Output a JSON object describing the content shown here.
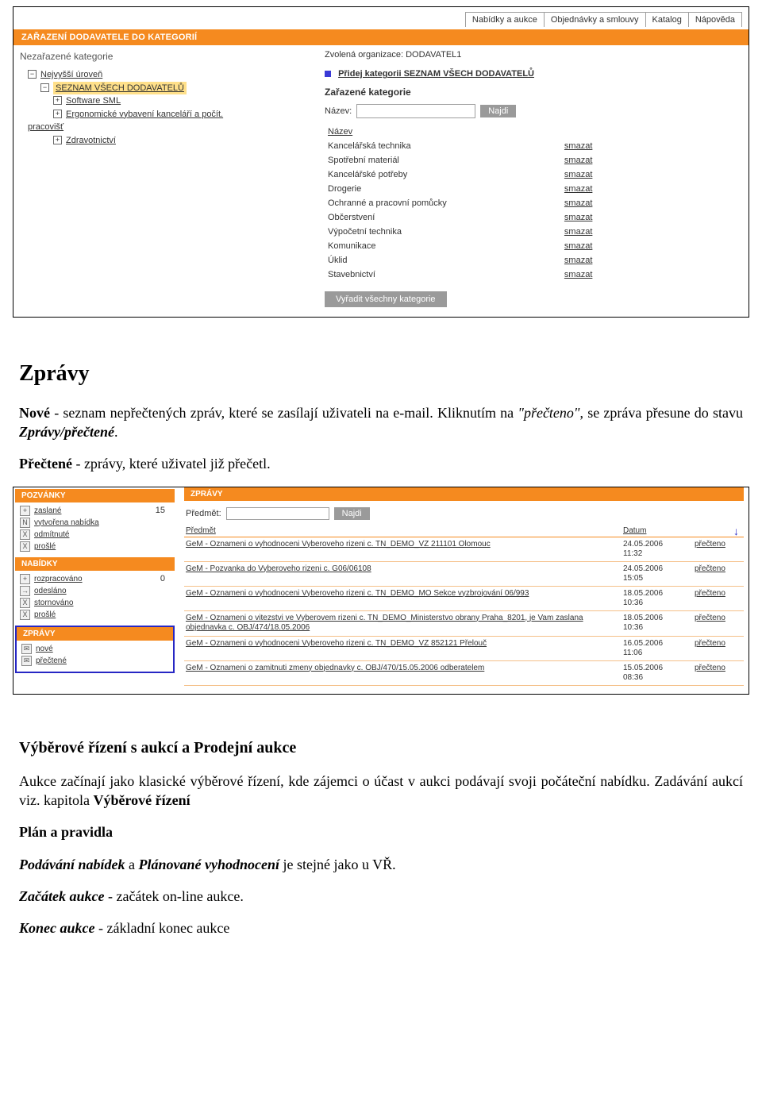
{
  "screenshot1": {
    "topnav": [
      "Nabídky a aukce",
      "Objednávky a smlouvy",
      "Katalog",
      "Nápověda"
    ],
    "orange_header": "ZAŘAZENÍ DODAVATELE DO KATEGORIÍ",
    "left": {
      "subhead": "Nezařazené kategorie",
      "tree": {
        "root": "Nejvyšší úroveň",
        "highlight": "SEZNAM VŠECH DODAVATELŮ",
        "n1": "Software SML",
        "n2a": "Ergonomické vybavení kanceláří a počít.",
        "n2b": "pracovišť",
        "n3": "Zdravotnictví"
      }
    },
    "right": {
      "org_label": "Zvolená organizace: DODAVATEL1",
      "add_link": "Přidej kategorii SEZNAM VŠECH DODAVATELŮ",
      "section": "Zařazené kategorie",
      "search_label": "Název:",
      "search_btn": "Najdi",
      "col_name": "Název",
      "rows": [
        {
          "name": "Kancelářská technika",
          "action": "smazat"
        },
        {
          "name": "Spotřební materiál",
          "action": "smazat"
        },
        {
          "name": "Kancelářské potřeby",
          "action": "smazat"
        },
        {
          "name": "Drogerie",
          "action": "smazat"
        },
        {
          "name": "Ochranné a pracovní pomůcky",
          "action": "smazat"
        },
        {
          "name": "Občerstvení",
          "action": "smazat"
        },
        {
          "name": "Výpočetní technika",
          "action": "smazat"
        },
        {
          "name": "Komunikace",
          "action": "smazat"
        },
        {
          "name": "Úklid",
          "action": "smazat"
        },
        {
          "name": "Stavebnictví",
          "action": "smazat"
        }
      ],
      "remove_all_btn": "Vyřadit všechny kategorie"
    }
  },
  "doc": {
    "h_zpravy": "Zprávy",
    "p_nove_1": "Nové",
    "p_nove_2": " - seznam nepřečtených zpráv, které se zasílají uživateli na e-mail. Kliknutím na ",
    "p_nove_3": "\"přečteno\"",
    "p_nove_4": ", se zpráva přesune do stavu ",
    "p_nove_5": "Zprávy/přečtené",
    "p_nove_6": ".",
    "p_prectene_1": "Přečtené",
    "p_prectene_2": " - zprávy, které uživatel již přečetl.",
    "h_aukce": "Výběrové řízení s aukcí a Prodejní aukce",
    "p_aukce": "Aukce začínají jako klasické výběrové řízení, kde zájemci o účast v aukci podávají svoji počáteční nabídku. Zadávání aukcí viz. kapitola ",
    "p_aukce_b": "Výběrové řízení",
    "h_plan": "Plán a pravidla",
    "p_plan_1a": "Podávání nabídek",
    "p_plan_1b": " a ",
    "p_plan_1c": "Plánované vyhodnocení",
    "p_plan_1d": " je stejné jako u VŘ.",
    "p_zacatek_1": "Začátek aukce",
    "p_zacatek_2": " - začátek on-line aukce.",
    "p_konec_1": "Konec aukce",
    "p_konec_2": " - základní konec aukce"
  },
  "screenshot2": {
    "left": {
      "pozvanky": {
        "head": "POZVÁNKY",
        "rows": [
          {
            "icon": "+",
            "label": "zaslané",
            "count": "15"
          },
          {
            "icon": "N",
            "label": "vytvořena nabídka",
            "count": ""
          },
          {
            "icon": "X",
            "label": "odmítnuté",
            "count": ""
          },
          {
            "icon": "X",
            "label": "prošlé",
            "count": ""
          }
        ]
      },
      "nabidky": {
        "head": "NABÍDKY",
        "rows": [
          {
            "icon": "+",
            "label": "rozpracováno",
            "count": "0"
          },
          {
            "icon": "→",
            "label": "odesláno",
            "count": ""
          },
          {
            "icon": "X",
            "label": "stornováno",
            "count": ""
          },
          {
            "icon": "X",
            "label": "prošlé",
            "count": ""
          }
        ]
      },
      "zpravy": {
        "head": "ZPRÁVY",
        "rows": [
          {
            "icon": "✉",
            "label": "nové",
            "count": ""
          },
          {
            "icon": "✉",
            "label": "přečtené",
            "count": ""
          }
        ]
      }
    },
    "right": {
      "head": "ZPRÁVY",
      "search_label": "Předmět:",
      "search_btn": "Najdi",
      "col_subj": "Předmět",
      "col_date": "Datum",
      "rows": [
        {
          "subj": "GeM - Oznameni o vyhodnoceni Vyberoveho rizeni c. TN_DEMO_VZ 211101 Olomouc",
          "date1": "24.05.2006",
          "date2": "11:32",
          "status": "přečteno"
        },
        {
          "subj": "GeM - Pozvanka do Vyberoveho rizeni c. G06/06108",
          "date1": "24.05.2006",
          "date2": "15:05",
          "status": "přečteno"
        },
        {
          "subj": "GeM - Oznameni o vyhodnoceni Vyberoveho rizeni c. TN_DEMO_MO Sekce vyzbrojování 06/993",
          "date1": "18.05.2006",
          "date2": "10:36",
          "status": "přečteno"
        },
        {
          "subj": "GeM - Oznameni o vitezstvi ve Vyberovem rizeni c. TN_DEMO_Ministerstvo obrany Praha_8201, je Vam zaslana objednavka c. OBJ/474/18.05.2006",
          "date1": "18.05.2006",
          "date2": "10:36",
          "status": "přečteno"
        },
        {
          "subj": "GeM - Oznameni o vyhodnoceni Vyberoveho rizeni c. TN_DEMO_VZ 852121 Přelouč",
          "date1": "16.05.2006",
          "date2": "11:06",
          "status": "přečteno"
        },
        {
          "subj": "GeM - Oznameni o zamitnuti zmeny objednavky c. OBJ/470/15.05.2006 odberatelem",
          "date1": "15.05.2006",
          "date2": "08:36",
          "status": "přečteno"
        }
      ]
    }
  }
}
